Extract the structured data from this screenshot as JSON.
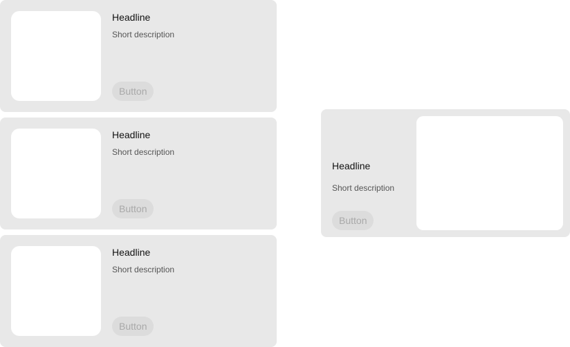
{
  "cards_list": [
    {
      "headline": "Headline",
      "description": "Short description",
      "button_label": "Button"
    },
    {
      "headline": "Headline",
      "description": "Short description",
      "button_label": "Button"
    },
    {
      "headline": "Headline",
      "description": "Short description",
      "button_label": "Button"
    }
  ],
  "card_feature": {
    "headline": "Headline",
    "description": "Short description",
    "button_label": "Button"
  },
  "colors": {
    "card_background": "#e8e8e8",
    "image_placeholder": "#ffffff",
    "button_background": "#dcdcdc",
    "button_text": "#a9a9a9",
    "headline_text": "#111111",
    "description_text": "#555555"
  }
}
